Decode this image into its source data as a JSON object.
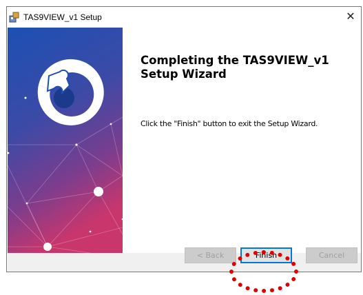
{
  "window": {
    "title": "TAS9VIEW_v1 Setup",
    "close_glyph": "✕",
    "app_icon": "installer-icon"
  },
  "content": {
    "heading": "Completing the TAS9VIEW_v1 Setup Wizard",
    "body": "Click the \"Finish\" button to exit the Setup Wizard."
  },
  "buttons": {
    "back": "< Back",
    "finish": "Finish",
    "cancel": "Cancel"
  },
  "colors": {
    "gradient_top": "#1f4fb0",
    "gradient_mid": "#5a3f9a",
    "gradient_bottom": "#c8346a",
    "focus_border": "#0078d7",
    "annotation": "#e00000"
  }
}
